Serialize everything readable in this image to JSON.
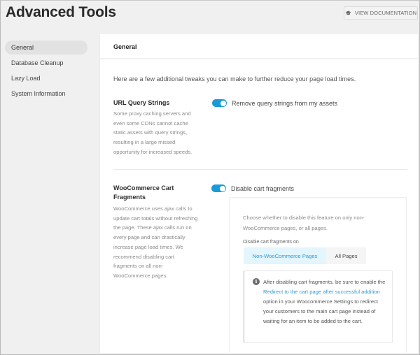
{
  "header": {
    "title": "Advanced Tools",
    "doc_button": {
      "label": "VIEW DOCUMENTATION",
      "icon": "graduation-cap-icon"
    }
  },
  "sidebar": {
    "items": [
      {
        "label": "General",
        "active": true
      },
      {
        "label": "Database Cleanup",
        "active": false
      },
      {
        "label": "Lazy Load",
        "active": false
      },
      {
        "label": "System Information",
        "active": false
      }
    ]
  },
  "main": {
    "section_title": "General",
    "intro": "Here are a few additional tweaks you can make to further reduce your page load times.",
    "settings": [
      {
        "label": "URL Query Strings",
        "description": "Some proxy caching servers and even some CDNs cannot cache static assets with query strings, resulting in a large missed opportunity for increased speeds.",
        "toggle_label": "Remove query strings from my assets",
        "enabled": true
      },
      {
        "label": "WooCommerce Cart Fragments",
        "description": "WooCommerce uses ajax calls to update cart totals without refreshing the page. These ajax calls run on every page and can drastically increase page load times. We recommend disabling cart fragments on all non-WooCommerce pages.",
        "toggle_label": "Disable cart fragments",
        "enabled": true,
        "panel": {
          "description": "Choose whether to disable this feature on only non-WooCommerce pages, or all pages.",
          "segment_label": "Disable cart fragments on",
          "options": [
            {
              "label": "Non-WooCommerce Pages",
              "selected": true
            },
            {
              "label": "All Pages",
              "selected": false
            }
          ],
          "notice": {
            "icon": "info-icon",
            "text_before": "After disabling cart fragments, be sure to enable the ",
            "link_text": "Redirect to the cart page after successful addition",
            "text_after": " option in your Woocommerce Settings to redirect your customers to the main cart page instead of waiting for an item to be added to the cart."
          }
        }
      }
    ]
  },
  "colors": {
    "accent": "#1a9ad6",
    "selected_segment_bg": "#e3f5fd",
    "link": "#2a9bd6",
    "page_bg": "#f0f0f0"
  }
}
